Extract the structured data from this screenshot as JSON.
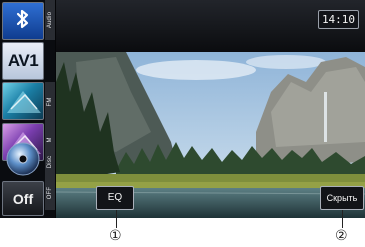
{
  "sidebar": {
    "items": [
      {
        "id": "bluetooth",
        "label": "Audio",
        "icon": "bluetooth-icon"
      },
      {
        "id": "av1",
        "button_text": "AV1"
      },
      {
        "id": "fm",
        "label": "FM",
        "icon": "fm-radio-icon"
      },
      {
        "id": "am",
        "label": "AM",
        "icon": "am-radio-icon"
      },
      {
        "id": "disc",
        "label": "Disc",
        "icon": "disc-icon"
      },
      {
        "id": "off",
        "button_text": "Off",
        "label": "OFF",
        "icon": "arrow-down-icon"
      }
    ]
  },
  "header": {
    "clock": "14:10"
  },
  "video": {
    "content": "landscape-video"
  },
  "controls": {
    "eq_label": "EQ",
    "hide_label": "Скрыть"
  },
  "callouts": {
    "first": "①",
    "second": "②"
  },
  "colors": {
    "bluetooth_accent": "#1f5fc8",
    "screen_bg": "#050608"
  }
}
